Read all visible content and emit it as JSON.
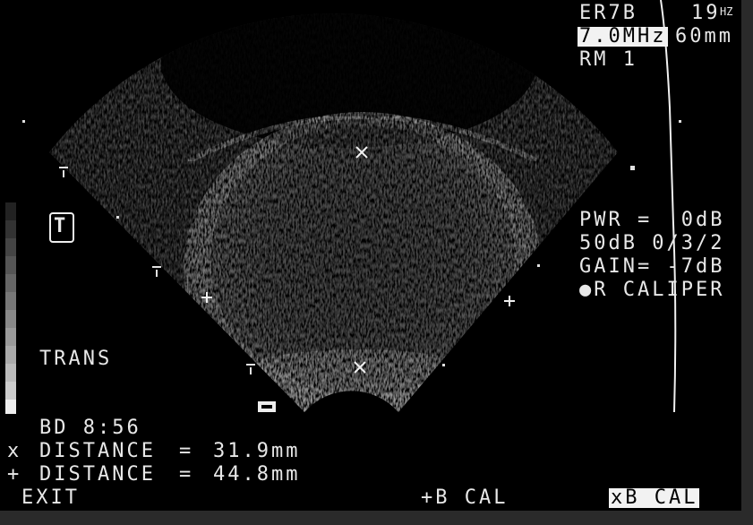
{
  "header": {
    "transducer": "ER7B",
    "frame_rate": "19",
    "frame_rate_unit": "HZ",
    "frequency": "7.0MHz",
    "depth": "60mm",
    "mode": "RM 1"
  },
  "settings": {
    "power": "PWR =  0dB",
    "dynamic": "50dB 0/3/2",
    "gain": "GAIN= -7dB",
    "caliper": "●R CALIPER"
  },
  "orientation_marker": "T",
  "plane_label": "TRANS",
  "bd_label": "BD 8:56",
  "measurements": [
    {
      "symbol": "x",
      "label": "DISTANCE",
      "value": "31.9mm"
    },
    {
      "symbol": "+",
      "label": "DISTANCE",
      "value": "44.8mm"
    }
  ],
  "footer": {
    "exit": "EXIT",
    "plus_cal": "+B CAL",
    "x_cal": "xB CAL"
  }
}
